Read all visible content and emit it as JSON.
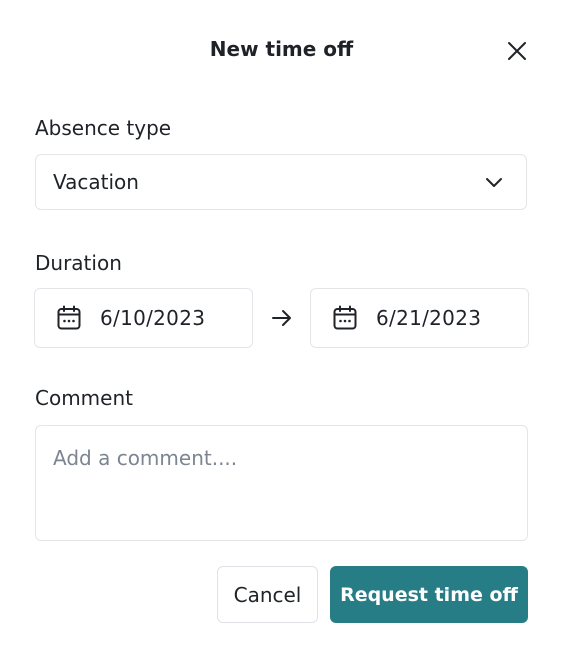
{
  "dialog": {
    "title": "New time off",
    "close_icon": "close-icon"
  },
  "absence_type": {
    "label": "Absence type",
    "value": "Vacation",
    "icon": "chevron-down-icon"
  },
  "duration": {
    "label": "Duration",
    "start_date": "6/10/2023",
    "end_date": "6/21/2023",
    "date_icon": "calendar-icon",
    "separator_icon": "arrow-right-icon"
  },
  "comment": {
    "label": "Comment",
    "placeholder": "Add a comment....",
    "value": ""
  },
  "actions": {
    "cancel_label": "Cancel",
    "submit_label": "Request time off"
  },
  "colors": {
    "primary": "#277d86",
    "border": "#e3e5e8",
    "text": "#1f2328",
    "placeholder": "#7c8591"
  }
}
